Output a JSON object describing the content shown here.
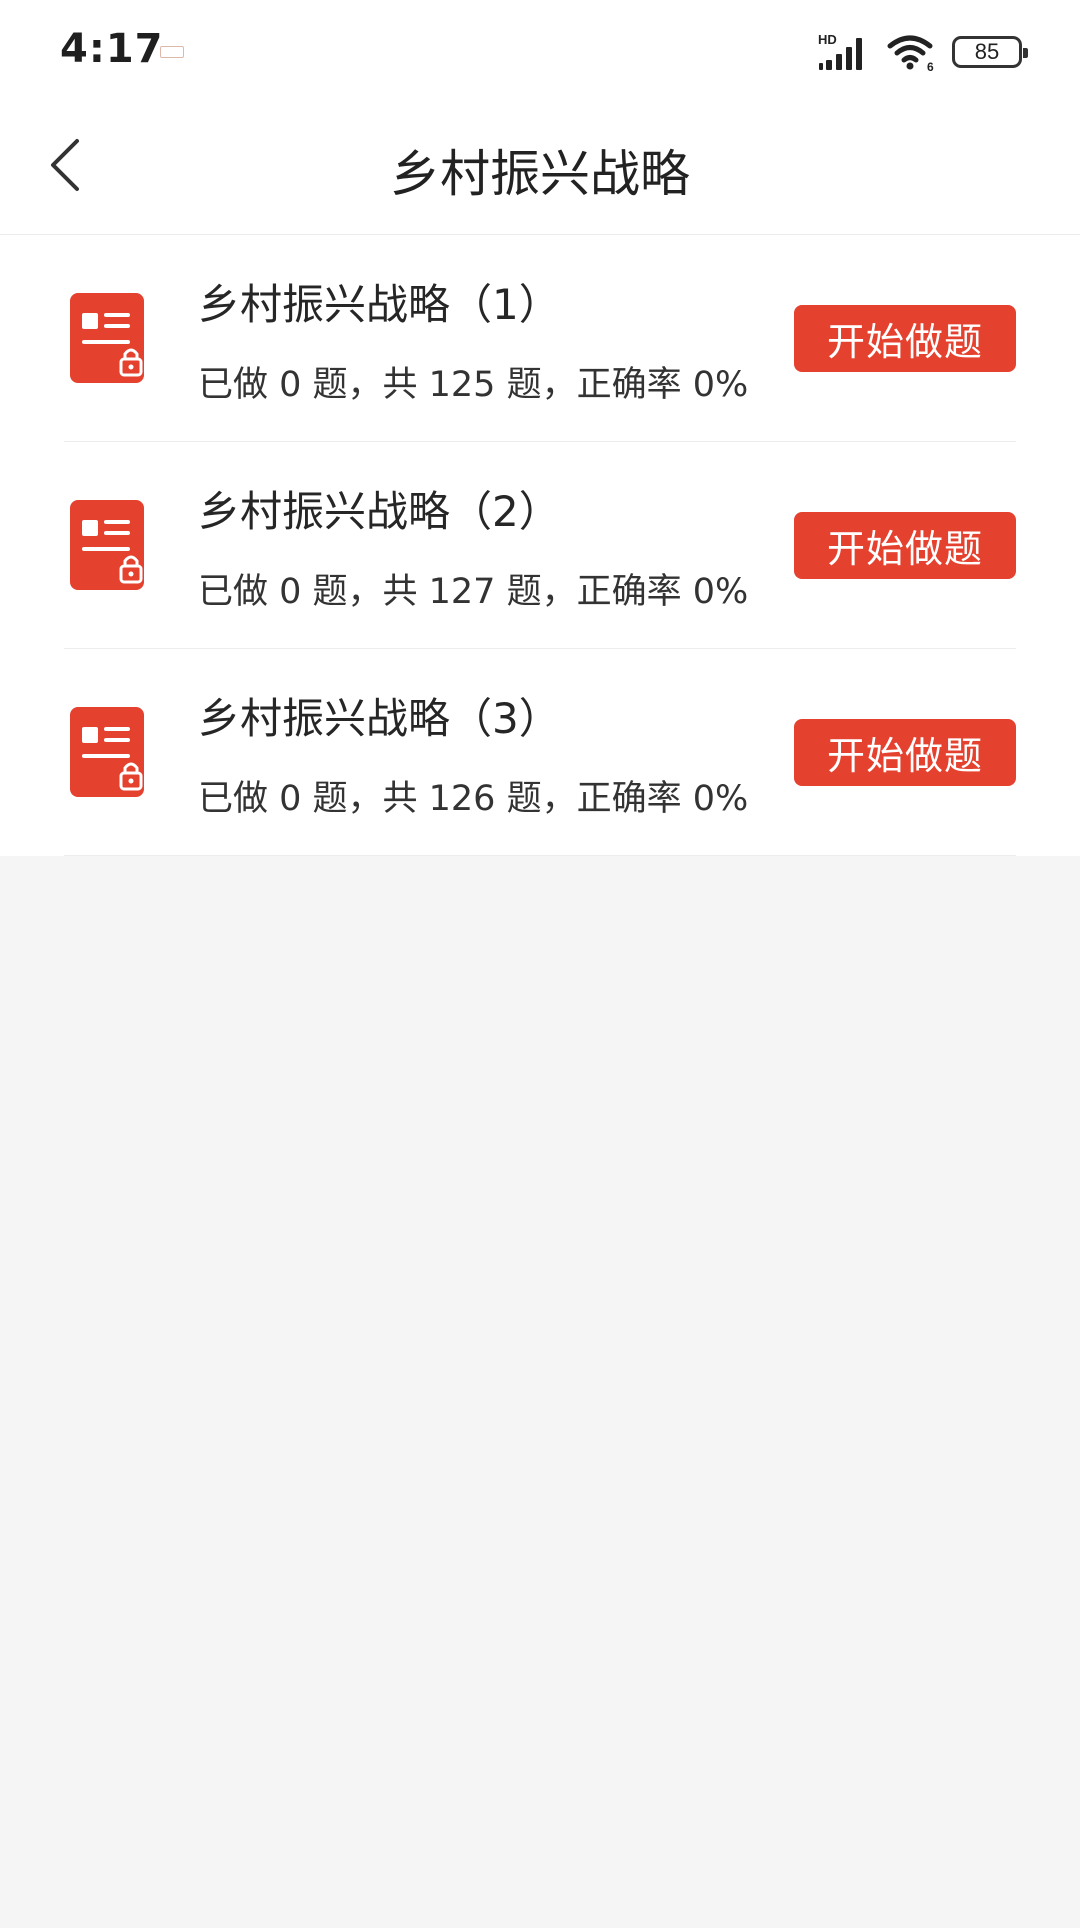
{
  "status_bar": {
    "time": "4:17",
    "network_label": "HD",
    "wifi_badge": "6",
    "battery_level": "85"
  },
  "header": {
    "title": "乡村振兴战略"
  },
  "colors": {
    "accent": "#e5412f",
    "background": "#f5f5f5"
  },
  "items": [
    {
      "title": "乡村振兴战略（1）",
      "stats": "已做 0 题，共 125 题，正确率 0%",
      "button_label": "开始做题",
      "icon": "locked-document-icon"
    },
    {
      "title": "乡村振兴战略（2）",
      "stats": "已做 0 题，共 127 题，正确率 0%",
      "button_label": "开始做题",
      "icon": "locked-document-icon"
    },
    {
      "title": "乡村振兴战略（3）",
      "stats": "已做 0 题，共 126 题，正确率 0%",
      "button_label": "开始做题",
      "icon": "locked-document-icon"
    }
  ]
}
